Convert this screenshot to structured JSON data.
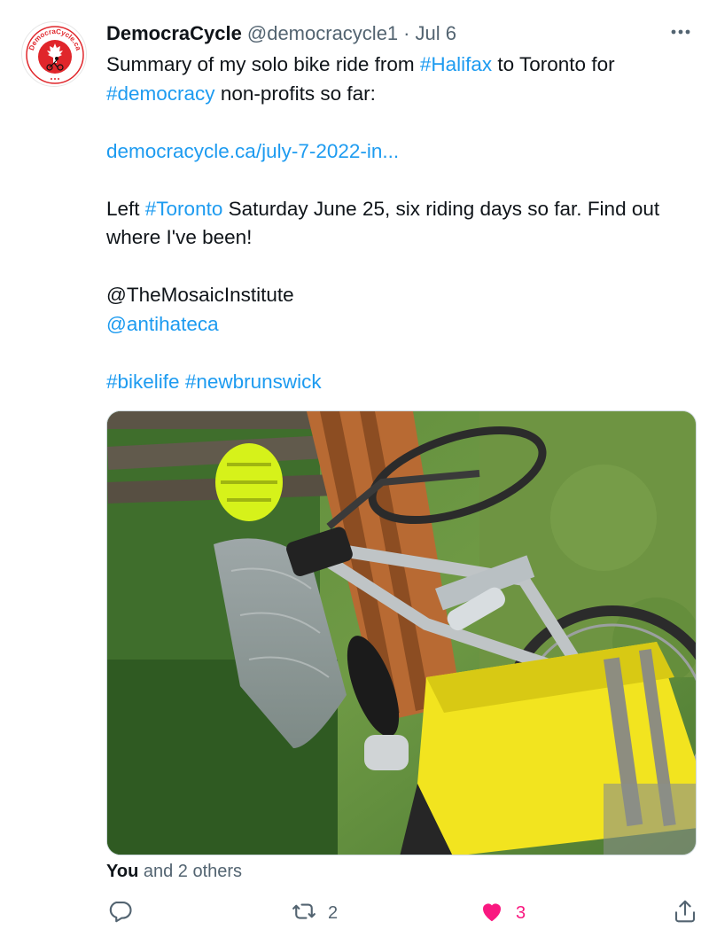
{
  "tweet": {
    "author_name": "DemocraCycle",
    "handle": "@democracycle1",
    "separator": "·",
    "date": "Jul 6",
    "more_icon": "more-horizontal-icon",
    "avatar_text": "DemocraCycle.ca",
    "text": {
      "line1_pre": "Summary of my solo bike ride from ",
      "hashtag_halifax": "#Halifax",
      "line1_post": " to Toronto for",
      "hashtag_democracy": "#democracy",
      "line2_post": " non-profits so far:",
      "link": "democracycle.ca/july-7-2022-in...",
      "para3_pre": "Left ",
      "hashtag_toronto": "#Toronto",
      "para3_post": " Saturday June 25, six riding days so far. Find out where I've been!",
      "mention_mosaic": "@TheMosaicInstitute",
      "mention_antihate": "@antihateca",
      "hashtag_bikelife": "#bikelife",
      "hashtag_nb": "#newbrunswick"
    },
    "likers": {
      "you": "You",
      "rest": " and 2 others"
    },
    "actions": {
      "reply_icon": "reply-icon",
      "retweet_icon": "retweet-icon",
      "retweet_count": "2",
      "like_icon": "heart-filled-icon",
      "like_count": "3",
      "share_icon": "share-icon"
    }
  },
  "colors": {
    "link": "#1d9bf0",
    "secondary": "#536471",
    "like": "#f91880",
    "avatar_red": "#e0262b"
  }
}
